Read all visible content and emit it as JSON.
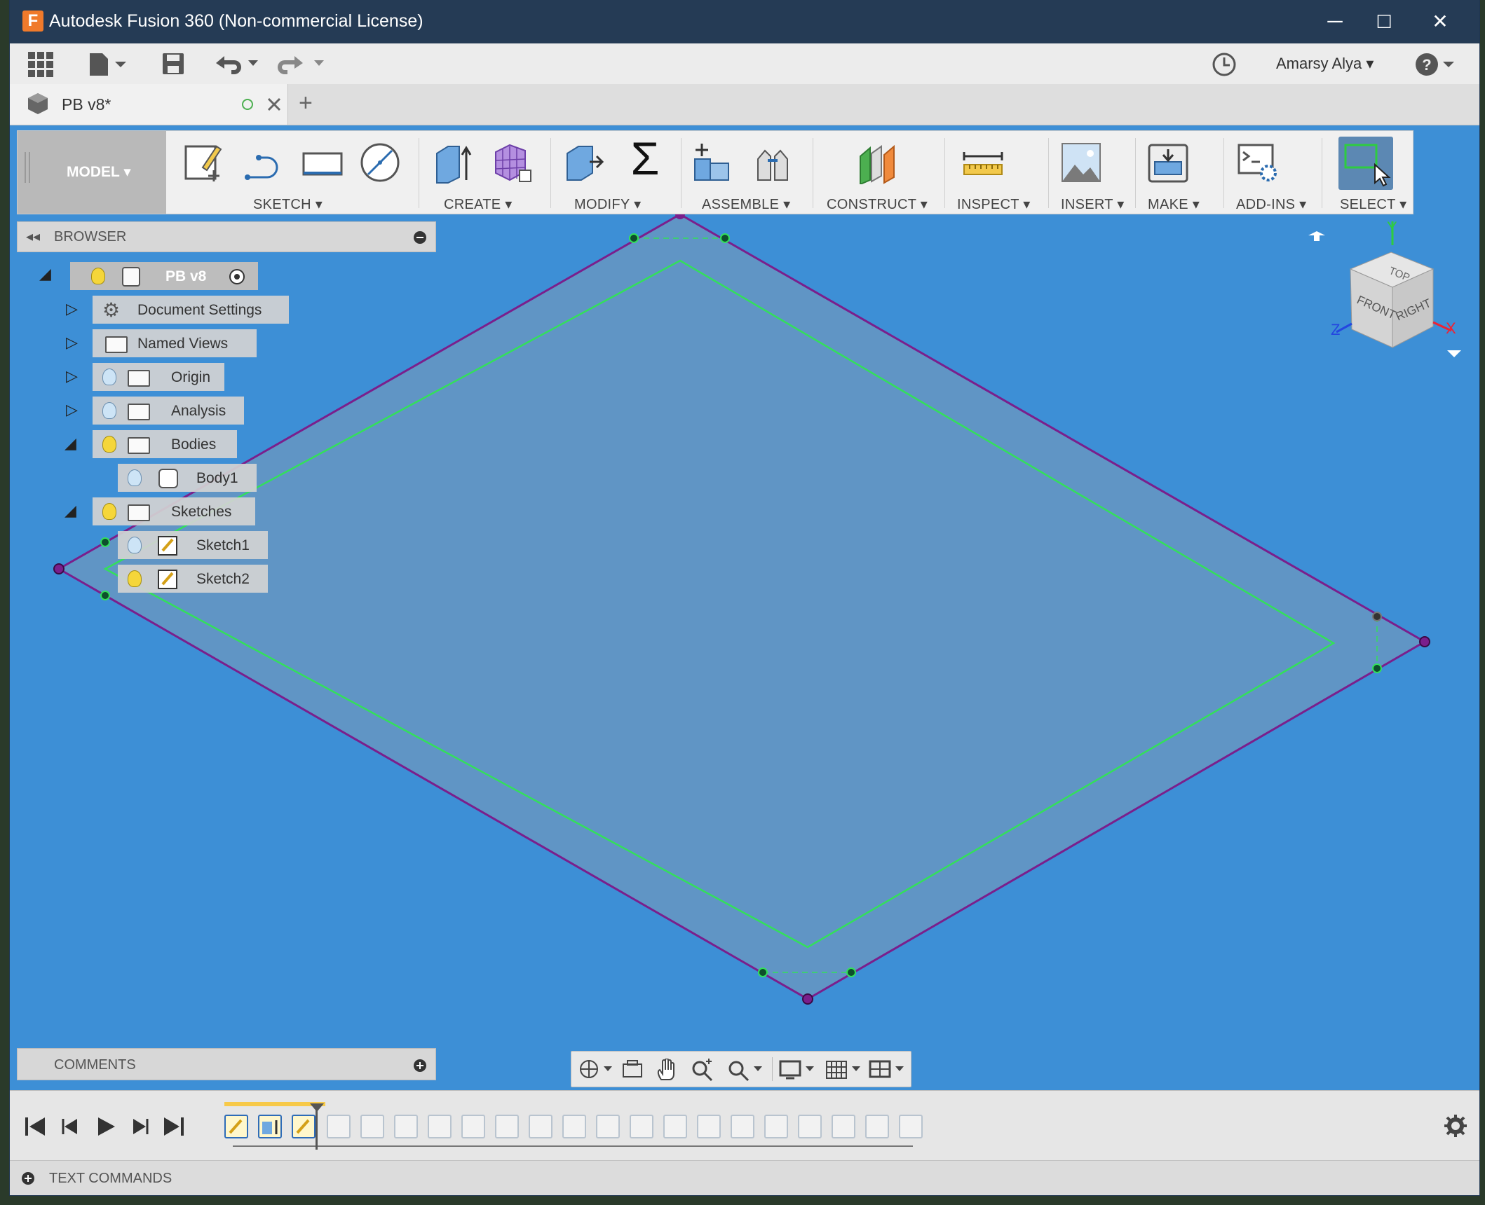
{
  "window": {
    "title": "Autodesk Fusion 360 (Non-commercial License)",
    "app_icon_letter": "F",
    "minimize": "─",
    "maximize": "☐",
    "close": "✕"
  },
  "quick_toolbar": {
    "grid_icon": "⊞",
    "file_icon": "📄",
    "save_icon": "💾",
    "undo_icon": "↶",
    "redo_icon": "↷",
    "history_icon": "🕒",
    "user": "Amarsy Alya ▾",
    "help_icon": "?"
  },
  "tab": {
    "title": "PB v8*",
    "add": "+"
  },
  "ribbon": {
    "mode": "MODEL ▾",
    "groups": [
      {
        "label": "SKETCH ▾"
      },
      {
        "label": "CREATE ▾"
      },
      {
        "label": "MODIFY ▾"
      },
      {
        "label": "ASSEMBLE ▾"
      },
      {
        "label": "CONSTRUCT ▾"
      },
      {
        "label": "INSPECT ▾"
      },
      {
        "label": "INSERT ▾"
      },
      {
        "label": "MAKE ▾"
      },
      {
        "label": "ADD-INS ▾"
      },
      {
        "label": "SELECT ▾"
      }
    ],
    "modify_sigma": "Σ"
  },
  "browser": {
    "title": "BROWSER",
    "root": "PB v8",
    "items": [
      {
        "label": "Document Settings"
      },
      {
        "label": "Named Views"
      },
      {
        "label": "Origin"
      },
      {
        "label": "Analysis"
      },
      {
        "label": "Bodies"
      },
      {
        "label": "Body1"
      },
      {
        "label": "Sketches"
      },
      {
        "label": "Sketch1"
      },
      {
        "label": "Sketch2"
      }
    ]
  },
  "comments": {
    "title": "COMMENTS"
  },
  "viewcube": {
    "top": "TOP",
    "front": "FRONT",
    "right": "RIGHT",
    "x": "X",
    "y": "Y",
    "z": "Z"
  },
  "text_commands": {
    "title": "TEXT COMMANDS"
  },
  "colors": {
    "viewport": "#3d8fd6",
    "profile_outline": "#7a1f8c",
    "sketch_line": "#33e05a",
    "title_bar": "#253b55"
  }
}
